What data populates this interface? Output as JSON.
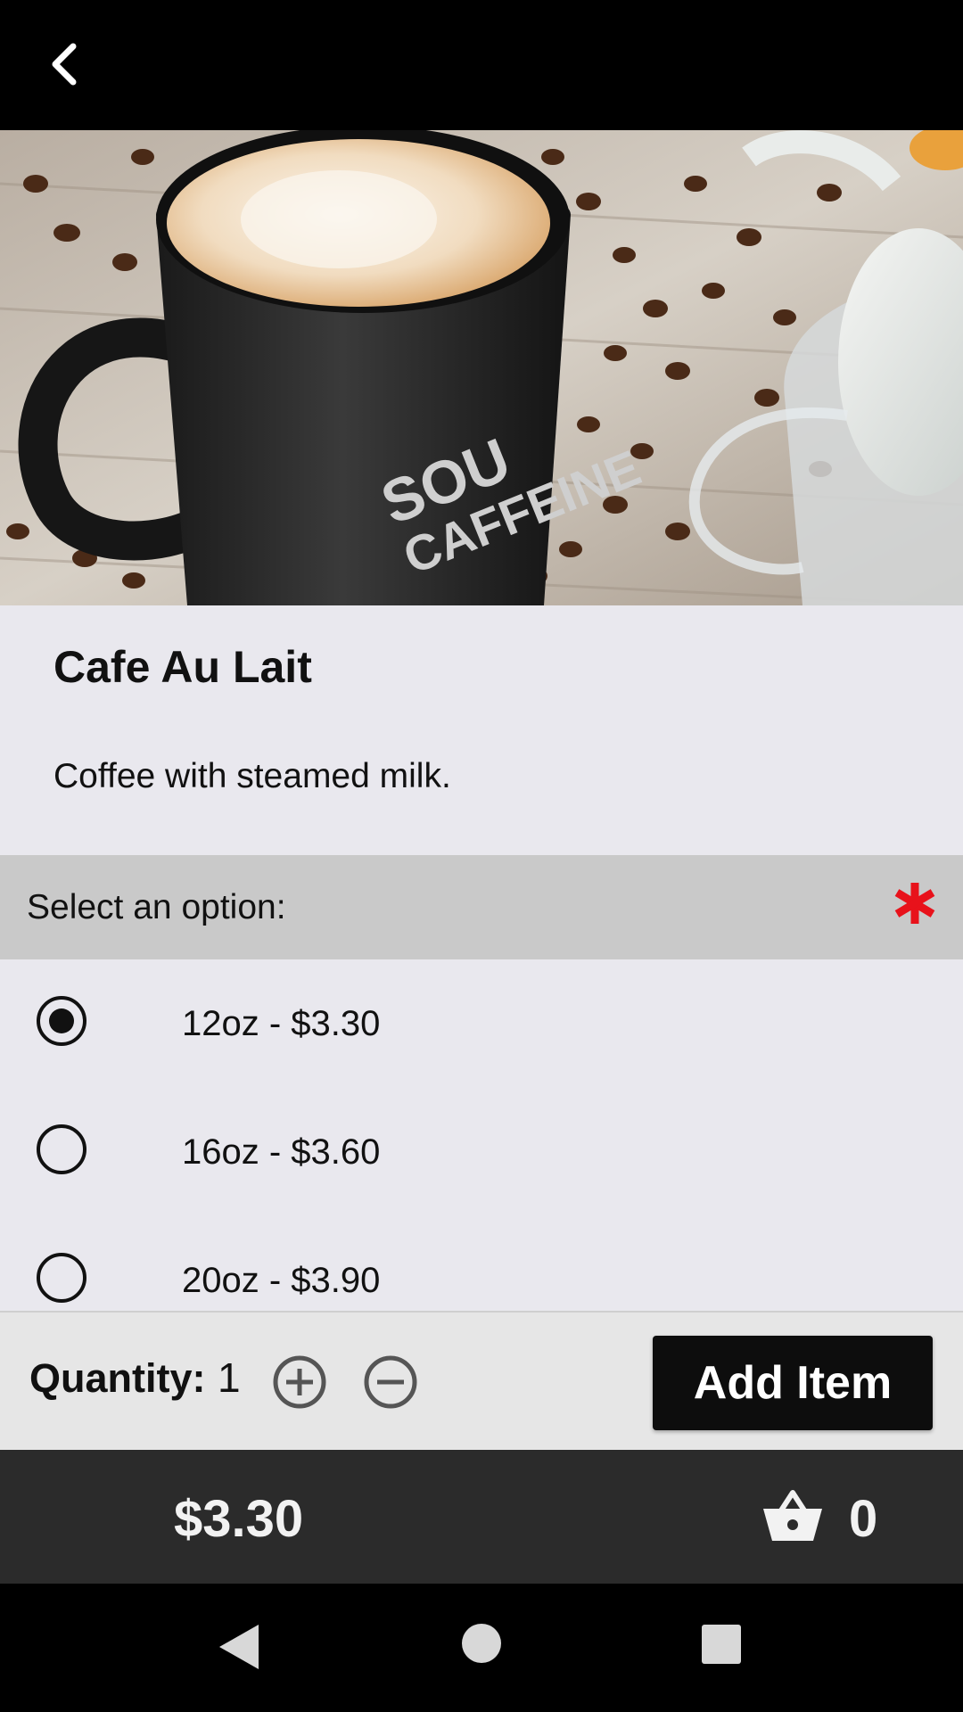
{
  "header": {
    "back_icon": "chevron-left-icon"
  },
  "hero": {
    "image": "coffee-mug-photo"
  },
  "item": {
    "title": "Cafe Au Lait",
    "description": "Coffee with steamed milk."
  },
  "options": {
    "header_label": "Select an option:",
    "required_icon": "asterisk-icon",
    "required_color": "#e8121b",
    "items": [
      {
        "label": "12oz - $3.30",
        "selected": true
      },
      {
        "label": "16oz - $3.60",
        "selected": false
      },
      {
        "label": "20oz - $3.90",
        "selected": false
      }
    ]
  },
  "quantity": {
    "label": "Quantity:",
    "value": "1",
    "plus_icon": "plus-circle-icon",
    "minus_icon": "minus-circle-icon"
  },
  "add_button": {
    "label": "Add Item"
  },
  "footer": {
    "total": "$3.30",
    "basket_icon": "basket-icon",
    "cart_count": "0"
  },
  "system_nav": [
    "back-triangle-icon",
    "home-circle-icon",
    "recents-square-icon"
  ]
}
